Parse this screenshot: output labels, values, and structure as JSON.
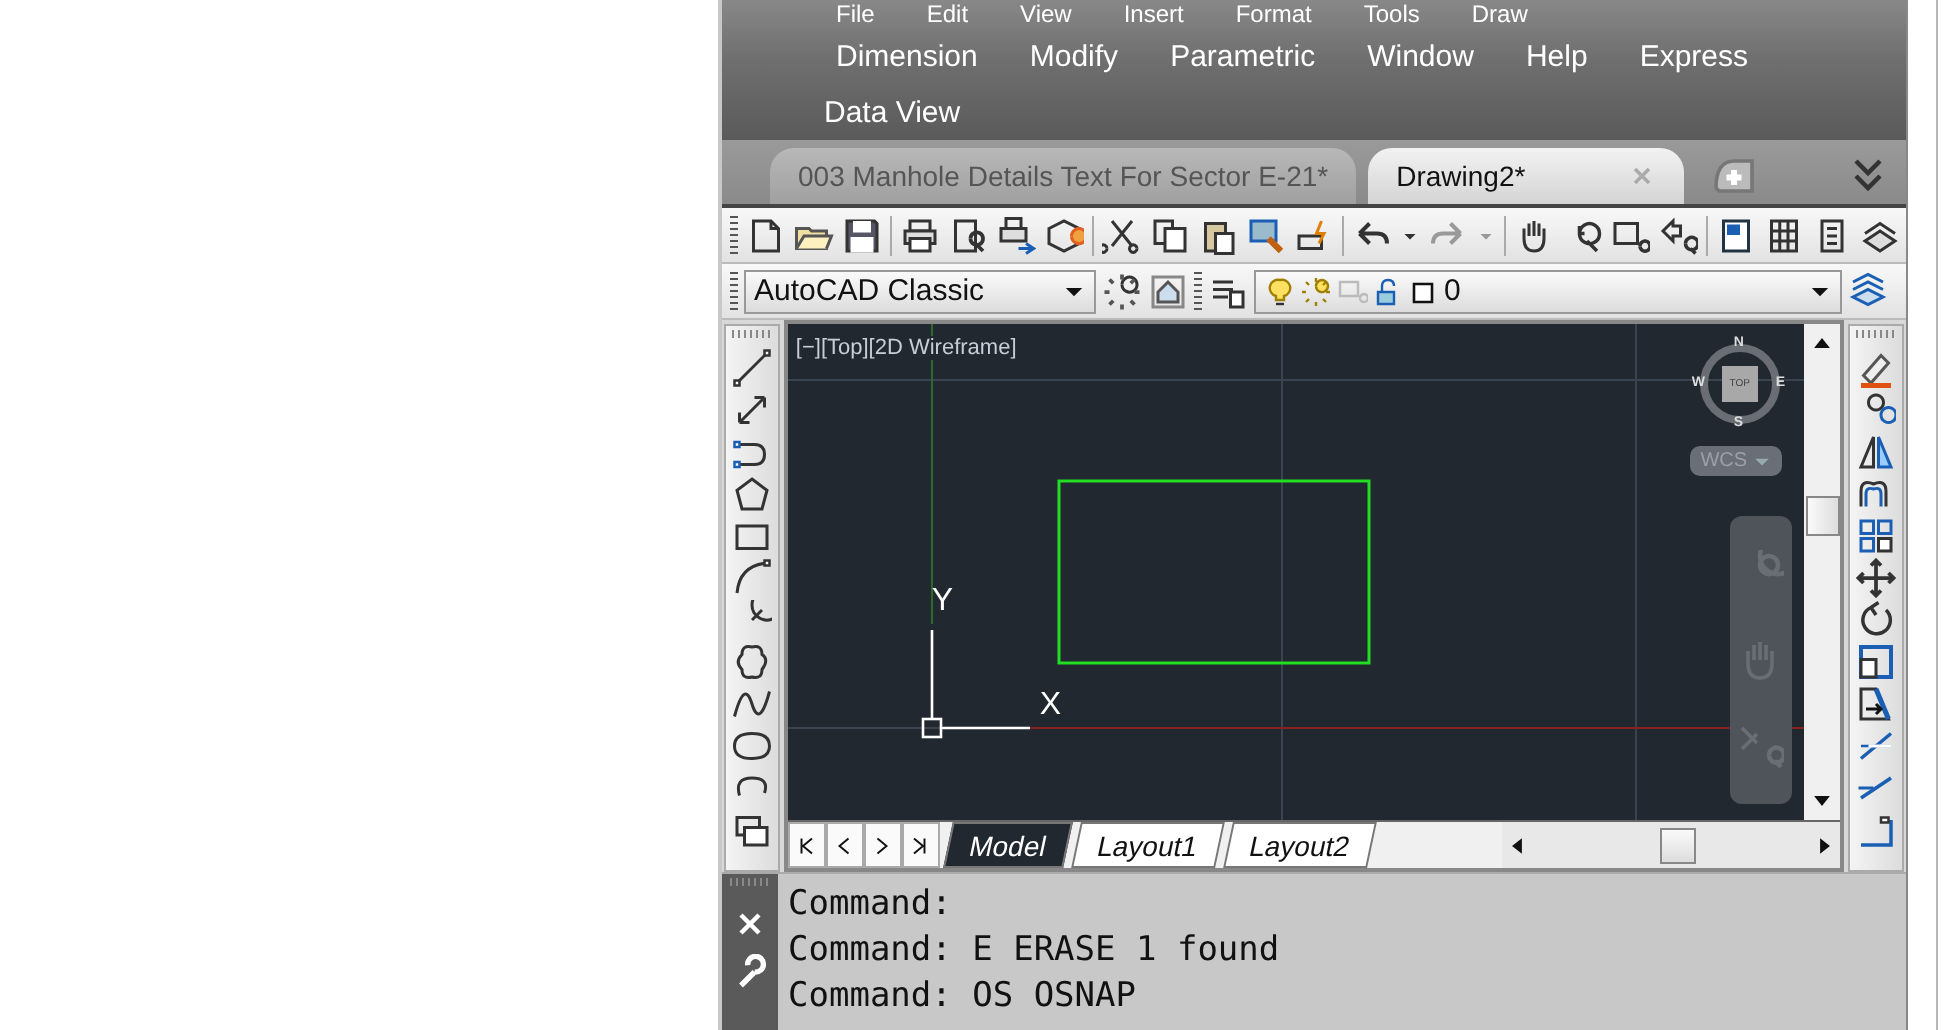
{
  "menu_rows": [
    {
      "items": [
        "File",
        "Edit",
        "View",
        "Insert",
        "Format",
        "Tools",
        "Draw"
      ]
    },
    {
      "items": [
        "Dimension",
        "Modify",
        "Parametric",
        "Window",
        "Help",
        "Express"
      ]
    },
    {
      "items": [
        "Data View"
      ]
    }
  ],
  "document_tabs": [
    {
      "label": "003 Manhole Details Text For Sector E-21*",
      "selected": false
    },
    {
      "label": "Drawing2*",
      "selected": true
    }
  ],
  "workspace": {
    "value": "AutoCAD Classic"
  },
  "layer": {
    "value": "0"
  },
  "viewport": {
    "label": "[−][Top][2D Wireframe]",
    "viewcube": {
      "north": "N",
      "west": "W",
      "east": "E",
      "south": "S",
      "face": "TOP"
    },
    "ucs_menu": "WCS",
    "ucs_axes": {
      "y": "Y",
      "x": "X"
    }
  },
  "layout_tabs": [
    {
      "label": "Model",
      "selected": true
    },
    {
      "label": "Layout1",
      "selected": false
    },
    {
      "label": "Layout2",
      "selected": false
    }
  ],
  "command_lines": [
    "Command:",
    "Command: E ERASE 1 found",
    "Command: OS OSNAP"
  ]
}
